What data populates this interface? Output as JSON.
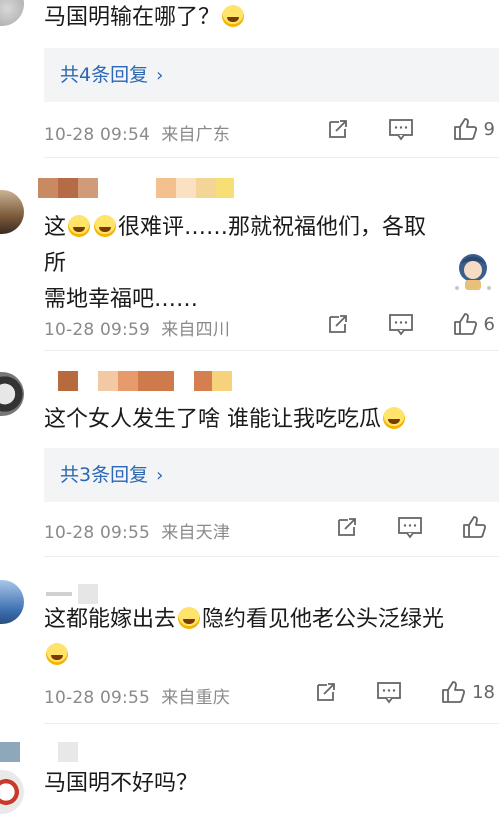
{
  "comments": [
    {
      "text": "马国明输在哪了？",
      "replies_label": "共4条回复",
      "time": "10-28 09:54",
      "location": "来自广东",
      "likes": "9"
    },
    {
      "text_part1": "这",
      "text_part2": "很难评……那就祝福他们，各取所",
      "text_line2": "需地幸福吧……",
      "time": "10-28 09:59",
      "location": "来自四川",
      "likes": "6"
    },
    {
      "text": "这个女人发生了啥 谁能让我吃吃瓜",
      "replies_label": "共3条回复",
      "time": "10-28 09:55",
      "location": "来自天津",
      "likes": ""
    },
    {
      "text_part1": "这都能嫁出去",
      "text_part2": "隐约看见他老公头泛绿光",
      "time": "10-28 09:55",
      "location": "来自重庆",
      "likes": "18"
    },
    {
      "text": "马国明不好吗？"
    }
  ],
  "colors": {
    "link": "#2c67b3",
    "meta": "#8a8a8a",
    "reply_bg": "#f3f4f6"
  },
  "icons": [
    "share-icon",
    "comment-icon",
    "like-icon",
    "chevron-right-icon",
    "emoji-icon"
  ]
}
